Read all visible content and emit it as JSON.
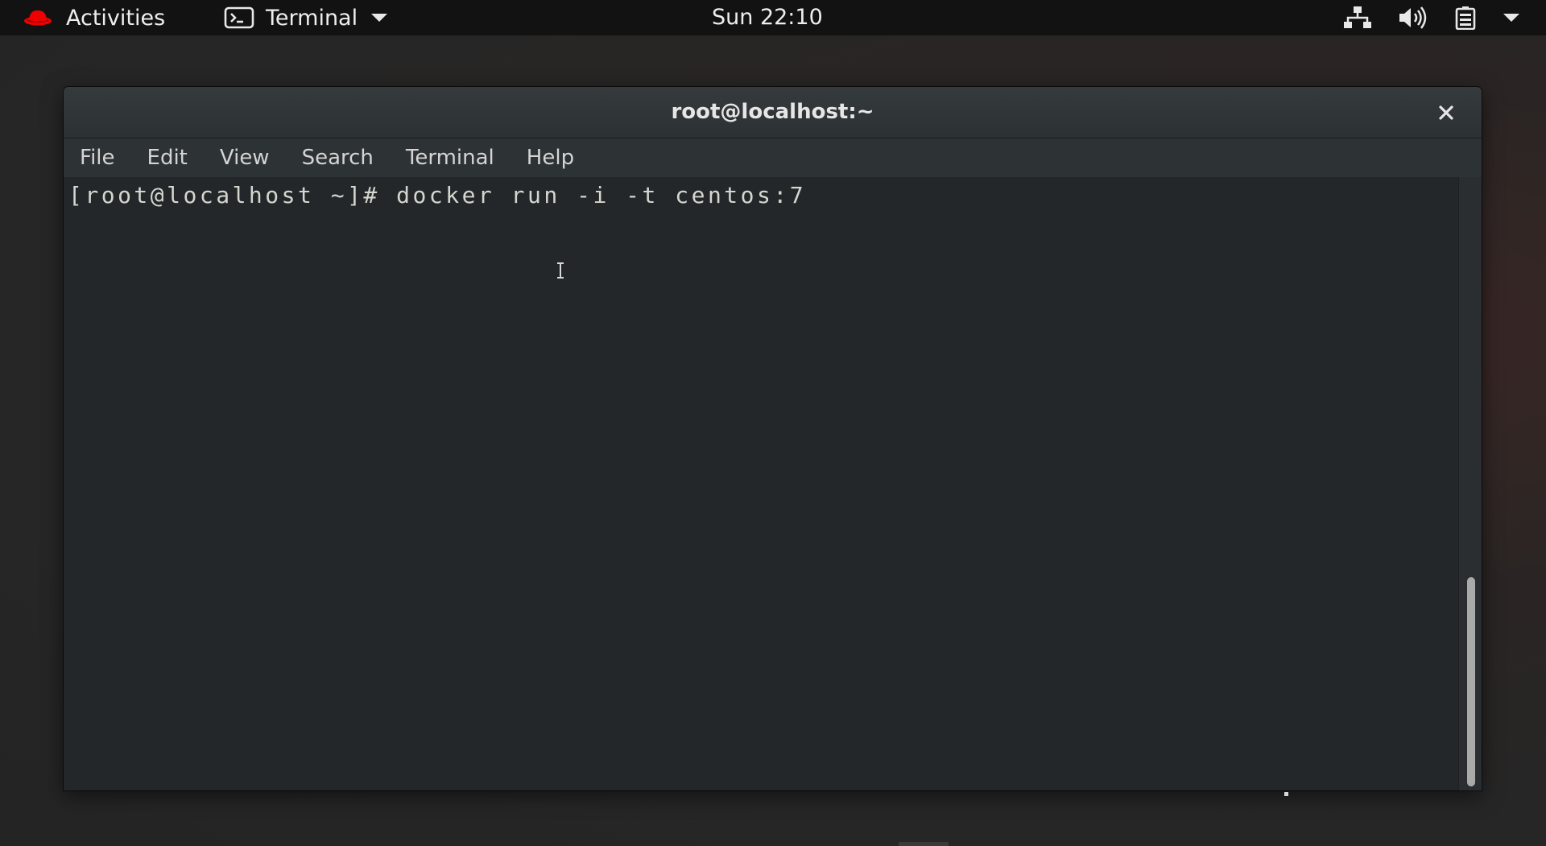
{
  "topbar": {
    "activities_label": "Activities",
    "app_name": "Terminal",
    "clock": "Sun 22:10",
    "icons": [
      "redhat-icon",
      "terminal-icon",
      "chevron-down-icon",
      "network-icon",
      "volume-icon",
      "battery-icon",
      "system-menu-chevron-icon"
    ]
  },
  "window": {
    "title": "root@localhost:~",
    "close_symbol": "close-icon",
    "menu": [
      "File",
      "Edit",
      "View",
      "Search",
      "Terminal",
      "Help"
    ],
    "terminal_lines": [
      "[root@localhost ~]# docker run -i -t centos:7"
    ]
  },
  "colors": {
    "topbar_bg": "#121212",
    "window_bg": "#232729",
    "menubar_bg": "#2d3234",
    "terminal_fg": "#d3d7cf",
    "brand_red": "#ee0000"
  }
}
